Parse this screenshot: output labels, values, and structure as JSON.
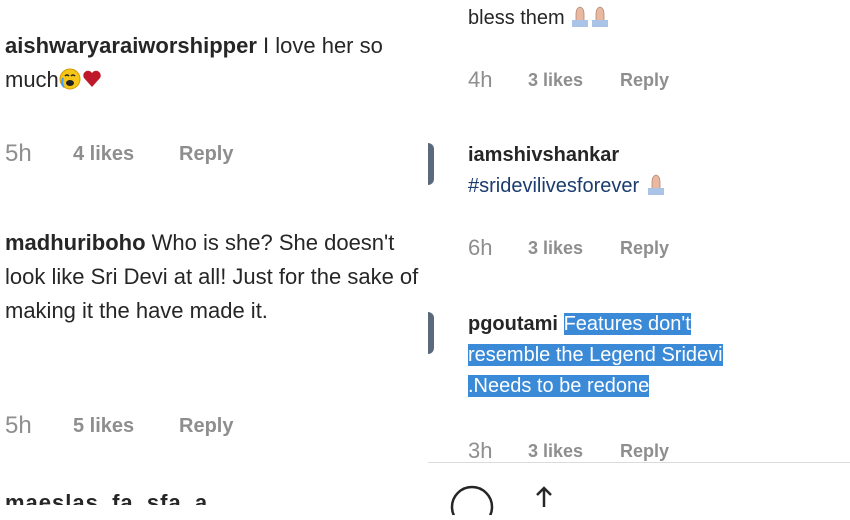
{
  "left": {
    "comments": [
      {
        "user": "aishwaryaraiworshipper",
        "text": "I love her so much",
        "time": "5h",
        "likes": "4 likes",
        "reply": "Reply"
      },
      {
        "user": "madhuriboho",
        "text": "Who is she? She doesn't look like Sri Devi at all! Just for the sake of making it the have made it.",
        "time": "5h",
        "likes": "5 likes",
        "reply": "Reply"
      }
    ],
    "cut_text": "maeslas_fa_sfa_a"
  },
  "right": {
    "comments": [
      {
        "text": "bless them",
        "time": "4h",
        "likes": "3 likes",
        "reply": "Reply"
      },
      {
        "user": "iamshivshankar",
        "hashtag": "#sridevilivesforever",
        "time": "6h",
        "likes": "3 likes",
        "reply": "Reply"
      },
      {
        "user": "pgoutami",
        "line1": "Features don't",
        "line2": "resemble the Legend Sridevi",
        "line3": ".Needs to be redone",
        "time": "3h",
        "likes": "3 likes",
        "reply": "Reply"
      }
    ]
  },
  "icons": [
    "crying-face-icon",
    "heart-icon",
    "praying-hands-icon",
    "comment-icon",
    "share-icon"
  ],
  "colors": {
    "highlight": "#3b8ad8",
    "meta": "#8e8e8e",
    "text": "#262626",
    "heart": "#c0182b"
  }
}
